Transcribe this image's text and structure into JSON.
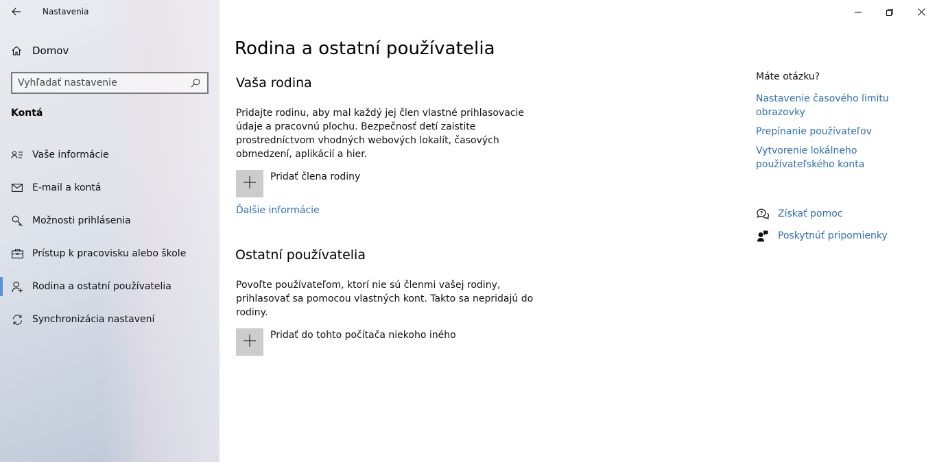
{
  "app": {
    "title": "Nastavenia"
  },
  "sidebar": {
    "home_label": "Domov",
    "search_placeholder": "Vyhľadať nastavenie",
    "section_title": "Kontá",
    "items": [
      {
        "label": "Vaše informácie",
        "icon": "contact-card-icon"
      },
      {
        "label": "E-mail a kontá",
        "icon": "mail-icon"
      },
      {
        "label": "Možnosti prihlásenia",
        "icon": "key-icon"
      },
      {
        "label": "Prístup k pracovisku alebo škole",
        "icon": "briefcase-icon"
      },
      {
        "label": "Rodina a ostatní používatelia",
        "icon": "person-add-icon",
        "active": true
      },
      {
        "label": "Synchronizácia nastavení",
        "icon": "sync-icon"
      }
    ]
  },
  "main": {
    "title": "Rodina a ostatní používatelia",
    "family": {
      "heading": "Vaša rodina",
      "description": "Pridajte rodinu, aby mal každý jej člen vlastné prihlasovacie údaje a pracovnú plochu. Bezpečnosť detí zaistite prostredníctvom vhodných webových lokalít, časových obmedzení, aplikácií a hier.",
      "add_label": "Pridať člena rodiny",
      "more_info": "Ďalšie informácie"
    },
    "others": {
      "heading": "Ostatní používatelia",
      "description": "Povoľte používateľom, ktorí nie sú členmi vašej rodiny, prihlasovať sa pomocou vlastných kont. Takto sa nepridajú do rodiny.",
      "add_label": "Pridať do tohto počítača niekoho iného"
    }
  },
  "aside": {
    "question": "Máte otázku?",
    "links": [
      "Nastavenie časového limitu obrazovky",
      "Prepínanie používateľov",
      "Vytvorenie lokálneho používateľského konta"
    ],
    "get_help": "Získať pomoc",
    "feedback": "Poskytnúť pripomienky"
  },
  "colors": {
    "accent": "#2e6fb9",
    "active_indicator": "#5b94d6",
    "add_tile": "#cccccc"
  }
}
